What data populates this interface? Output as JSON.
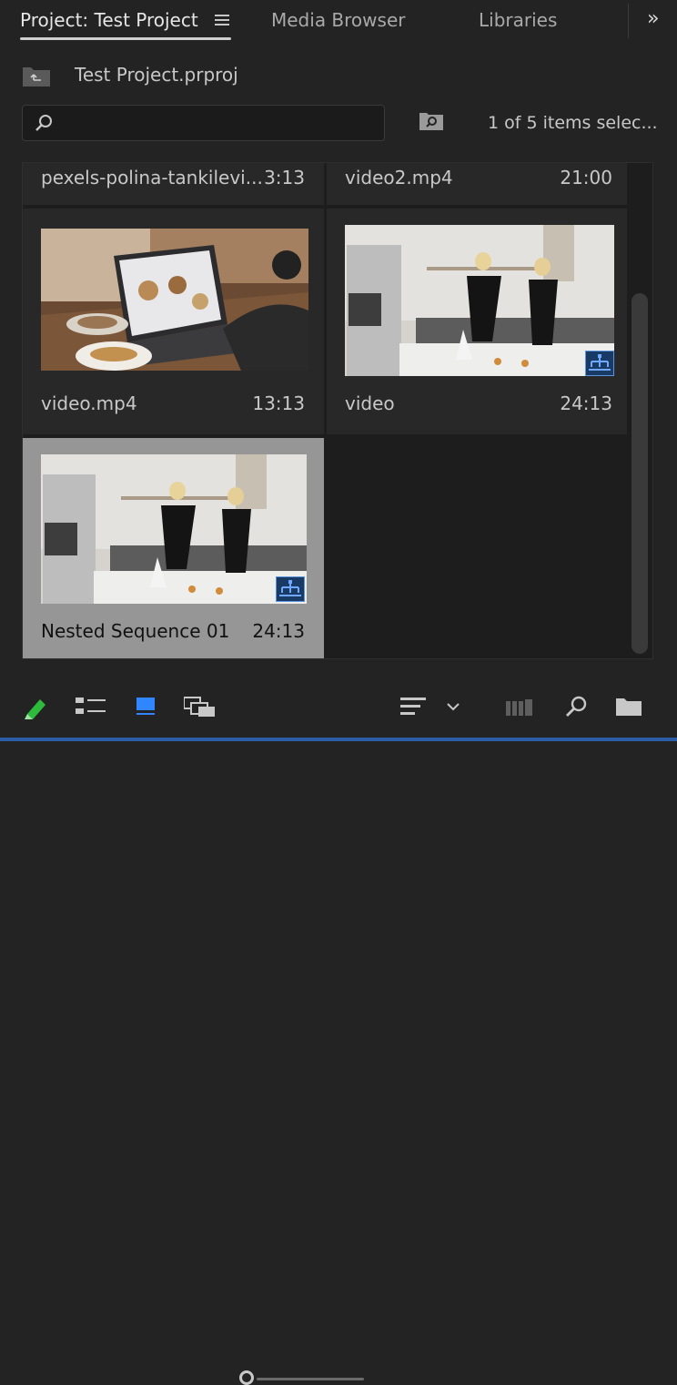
{
  "tabs": [
    {
      "label": "Project: Test Project",
      "active": true
    },
    {
      "label": "Media Browser",
      "active": false
    },
    {
      "label": "Libraries",
      "active": false
    }
  ],
  "project": {
    "filename": "Test Project.prproj"
  },
  "search": {
    "placeholder": "",
    "value": ""
  },
  "selection_count": "1 of 5 items selec...",
  "items": [
    {
      "name": "pexels-polina-tankilevi...",
      "duration": "3:13"
    },
    {
      "name": "video2.mp4",
      "duration": "21:00"
    },
    {
      "name": "video.mp4",
      "duration": "13:13"
    },
    {
      "name": "video",
      "duration": "24:13"
    },
    {
      "name": "Nested Sequence 01",
      "duration": "24:13",
      "selected": true
    }
  ],
  "colors": {
    "accent": "#2a5fa8",
    "pencil": "#2dbb3c",
    "selected": "#969696"
  }
}
